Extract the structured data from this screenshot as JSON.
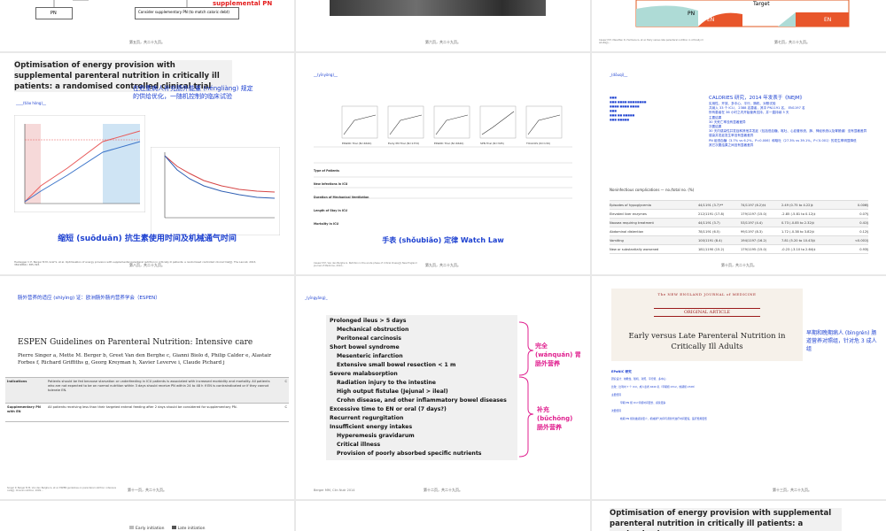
{
  "slides": {
    "s1": {
      "box_pn": "PN",
      "box_consider": "Consider supplementary PN (to match caloric debt)",
      "red_label": "supplemental PN",
      "footer": "第五页，共二十九页。"
    },
    "s2": {
      "footer": "第六页，共二十九页。"
    },
    "s3": {
      "label_pn": "PN",
      "label_en": "EN",
      "label_en2": "EN",
      "label_target": "Target",
      "cite": "Casaer M P, Mesotten D, Hermans G, et al. Early versus late parenteral nutrition in critically ill adults[J]...",
      "footer": "第七页，共二十九页。"
    },
    "s4": {
      "title": "Optimisation of energy provision with supplemental parenteral nutrition in critically ill patients: a randomised controlled clinical trial",
      "cn_note": "在危重病人补充肠外能量 (néngliàng) 规定的供给优化，一随机控制的临床试验",
      "pinyin_small": "____(tiáo hòng)__",
      "caption": "缩短 (suōduǎn) 抗生素使用时间及机械通气时间",
      "cite": "Heidegger C P, Berger M M, Graf S, et al. Optimisation of energy provision with supplemental parenteral nutrition in critically ill patients: a randomised controlled clinical trial[J]. The Lancet, 2013, 381(9864): 385-393.",
      "footer": "第八页，共二十九页。"
    },
    "s5": {
      "header": "__(yīnyòng)__",
      "caption": "手表 (shǒubiǎo) 定律  Watch Law",
      "row_labels": [
        "Type of Patients",
        "New infections in ICU",
        "Duration of Mechanical Ventilation",
        "Length of Stay in ICU",
        "Mortality in ICU"
      ],
      "trials": [
        "EPaNIC Trial (N=4640)",
        "Early PN Trial (N=1372)",
        "EPaNIC Trial (N=4640)",
        "SPN Trial (N=305)",
        "TICACOS (N=130)"
      ],
      "cite": "Casaer M P, Van den Berghe G. Nutrition in the acute phase of critical illness[J]. New England Journal of Medicine, 2014...",
      "footer": "第九页，共二十九页。"
    },
    "s6": {
      "header": "_(dōuqi)__",
      "calories_title": "CALORIES 研究，2014 年发表于《NEJM》",
      "bullets": [
        "实用性、开放、多中心、平行、随机、对照试验",
        "共纳入 33 个 ICU， 2388 名患者，其中 PN1191 名， EN1197 名",
        "所有患者在 36 小时之内开始营养支持，并一直持续 5 天",
        "主要结果",
        "30 天死亡率没有显著差异",
        "次要结果",
        "30 天内感染性并发症和其他并发症（包括低血糖、呕吐、心血管系统、肺、神经系统以及胃肠道）没有显著差异",
        "感染并发症发生率没有显著差异",
        "PN 组低血糖（3.7% vs 6.2%，P=0.006）和呕吐（27.3% vs 39.1%，P＜0.001）的发生率明显降低",
        "其它次要结果之间没有显著差异"
      ],
      "table_title": "Noninfectious complications — no./total no. (%)",
      "table_rows": [
        [
          "Episodes of hypoglycemia",
          "44/1191 (3.7)**",
          "74/1197 (6.2)†‡",
          "2.49 (0.75 to 4.22)‡",
          "0.006§"
        ],
        [
          "Elevated liver enzymes",
          "212/1191 (17.8)",
          "179/1197 (15.0)",
          "-2.85 (-5.81 to 0.12)‡",
          "0.07§"
        ],
        [
          "Nausea requiring treatment",
          "44/1191 (3.7)",
          "53/1197 (4.4)",
          "0.73 (-0.85 to 2.32)‡",
          "0.41§"
        ],
        [
          "Abdominal distention",
          "78/1191 (6.5)",
          "99/1197 (8.3)",
          "1.72 (-0.38 to 3.82)‡",
          "0.12§"
        ],
        [
          "Vomiting",
          "100/1191 (8.4)",
          "194/1197 (16.2)",
          "7.81 (5.20 to 10.43)‡",
          "<0.001§"
        ],
        [
          "New or substantially worsened",
          "181/1190 (15.2)",
          "179/1195 (15.0)",
          "-0.23 (-3.10 to 2.64)‡",
          "0.93§"
        ]
      ],
      "footer": "第十页，共二十九页。"
    },
    "s7": {
      "header": "肠外营养的适应 (shìyìng) 证：欧洲肠外肠内营养学会（ESPEN）",
      "title": "ESPEN Guidelines on Parenteral Nutrition: Intensive care",
      "authors": "Pierre Singer a, Mette M. Berger b, Greet Van den Berghe c, Gianni Biolo d, Philip Calder e, Alastair Forbes f, Richard Griffiths g, Georg Kreyman h, Xavier Leverve i, Claude Pichard j",
      "rows": [
        {
          "label": "Indications",
          "text": "Patients should be fed because starvation or underfeeding in ICU patients is associated with increased morbidity and mortality. All patients who are not expected to be on normal nutrition within 3 days should receive PN within 24 to 48 h if EN is contraindicated or if they cannot tolerate EN.",
          "grade": "C"
        },
        {
          "label": "Supplementary PN with EN",
          "text": "All patients receiving less than their targeted enteral feeding after 2 days should be considered for supplementary PN.",
          "grade": "C"
        }
      ],
      "cite": "Singer P, Berger M M, Van den Berghe G, et al. ESPEN guidelines on parenteral nutrition: intensive care[J]. Clinical nutrition, 2009...",
      "footer": "第十一页，共二十九页。"
    },
    "s8": {
      "header": "_(yīngyǎng)_",
      "list": [
        {
          "text": "Prolonged ileus > 5 days",
          "indent": false
        },
        {
          "text": "Mechanical obstruction",
          "indent": true
        },
        {
          "text": "Peritoneal carcinosis",
          "indent": true
        },
        {
          "text": "Short bowel syndrome",
          "indent": false
        },
        {
          "text": "Mesenteric infarction",
          "indent": true
        },
        {
          "text": "Extensive small bowel resection < 1 m",
          "indent": true
        },
        {
          "text": "Severe malabsorption",
          "indent": false
        },
        {
          "text": "Radiation injury to the intestine",
          "indent": true
        },
        {
          "text": "High output fistulae (Jejunal > ileal)",
          "indent": true
        },
        {
          "text": "Crohn disease, and other inflammatory bowel diseases",
          "indent": true
        },
        {
          "text": "Excessive time to EN or oral (7 days?)",
          "indent": false
        },
        {
          "text": "Recurrent regurgitation",
          "indent": false
        },
        {
          "text": "Insufficient energy intakes",
          "indent": false
        },
        {
          "text": "Hyperemesis gravidarum",
          "indent": true
        },
        {
          "text": "Critical illness",
          "indent": true
        },
        {
          "text": "Provision of poorly absorbed specific nutrients",
          "indent": true
        }
      ],
      "label_full": "完全 (wánquán) 胃肠外营养",
      "label_supp": "补充 (bǔchōng) 肠外营养",
      "cite": "Berger MM, Clin Nutr 2014",
      "footer": "第十二页，共二十九页。"
    },
    "s9": {
      "journal": "The NEW ENGLAND JOURNAL of MEDICINE",
      "article_type": "ORIGINAL ARTICLE",
      "title": "Early versus Late Parenteral Nutrition in Critically Ill Adults",
      "cn_note": "早期和晚期病人 (bìngrén) 肠道营养对照组，针对危 3 成人组",
      "subhead": "EPaNIC 研究",
      "lines": [
        "研究设计：前瞻性、随机、对照、平行组、多中心",
        "比较：比利时 7 个 ICU，成人患者 4640 名（早期组 2312，晚期组 2328）",
        "主要结局",
        "早期 PN 组 ICU 停留时间更长、感染更多",
        "次要结局",
        "晚期 PN 组新发感染更少，机械通气时间与肾替代治疗时间更短，医疗费用更低"
      ],
      "footer": "第十三页，共二十九页。"
    },
    "s10": {
      "legend_early": "Early initiation",
      "legend_late": "Late initiation"
    },
    "s11": {},
    "s12": {
      "title": "Optimisation of energy provision with supplemental parenteral nutrition in critically ill patients: a randomised"
    }
  }
}
